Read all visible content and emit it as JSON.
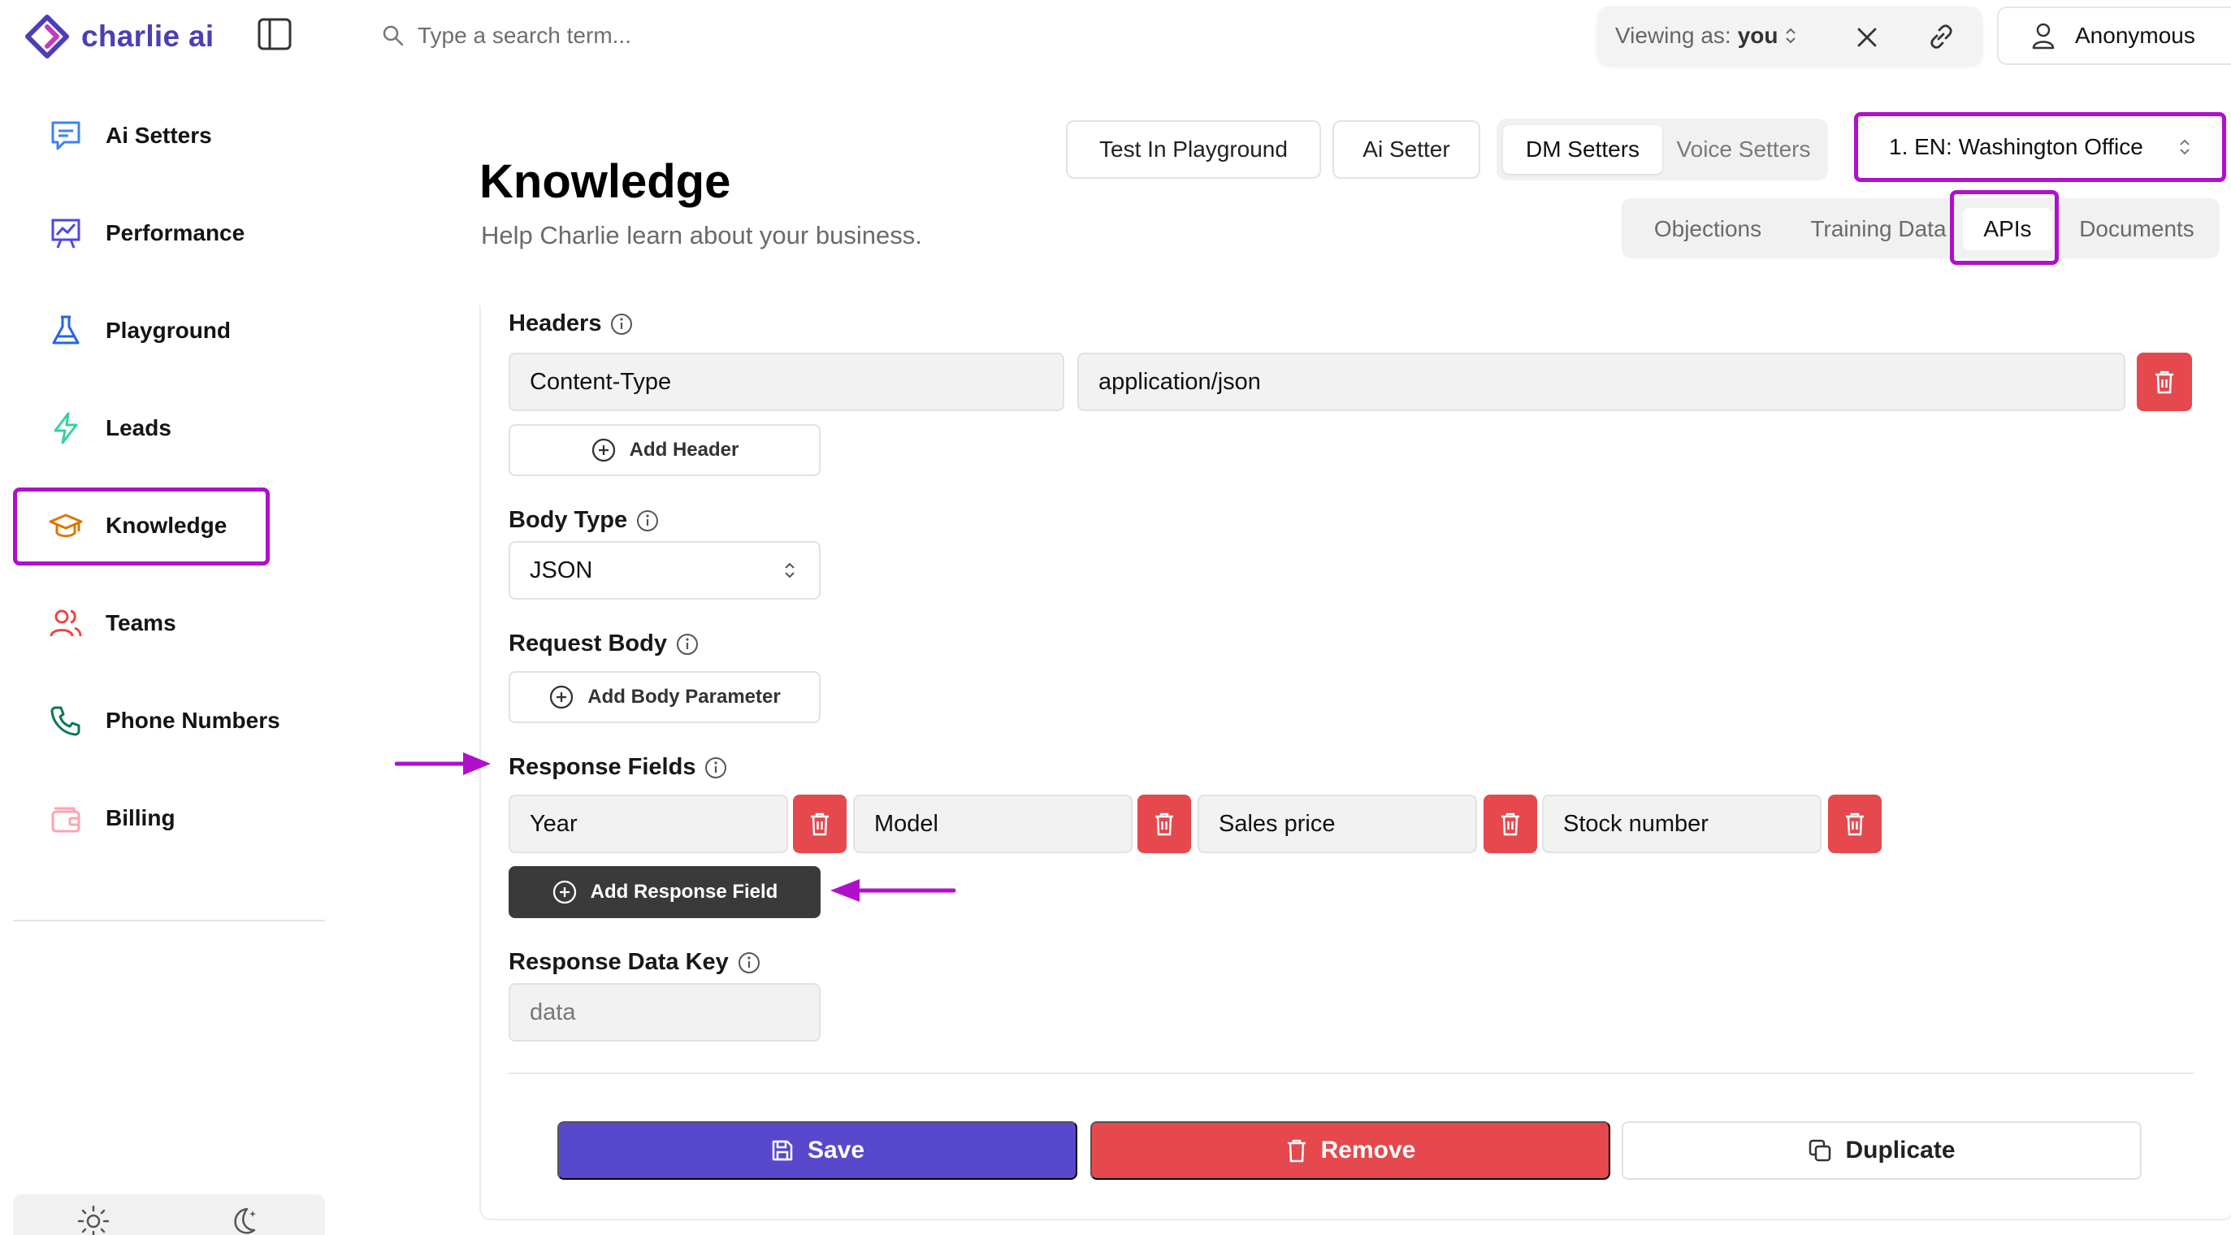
{
  "app": {
    "name": "charlie ai"
  },
  "search": {
    "placeholder": "Type a search term..."
  },
  "viewing": {
    "prefix": "Viewing as:",
    "value": "you"
  },
  "user": {
    "name": "Anonymous"
  },
  "sidebar": {
    "items": [
      {
        "label": "Ai Setters",
        "icon": "chat-icon"
      },
      {
        "label": "Performance",
        "icon": "chart-icon"
      },
      {
        "label": "Playground",
        "icon": "flask-icon"
      },
      {
        "label": "Leads",
        "icon": "lightning-icon"
      },
      {
        "label": "Knowledge",
        "icon": "graduation-cap-icon"
      },
      {
        "label": "Teams",
        "icon": "users-icon"
      },
      {
        "label": "Phone Numbers",
        "icon": "phone-icon"
      },
      {
        "label": "Billing",
        "icon": "wallet-icon"
      }
    ]
  },
  "header": {
    "title": "Knowledge",
    "subtitle": "Help Charlie learn about your business.",
    "test_playground": "Test In Playground",
    "ai_setter": "Ai Setter",
    "setter_types": [
      "DM Setters",
      "Voice Setters"
    ],
    "office": "1. EN: Washington Office",
    "tabs": [
      "Objections",
      "Training Data",
      "APIs",
      "Documents"
    ]
  },
  "form": {
    "headers": {
      "label": "Headers",
      "rows": [
        {
          "key": "Content-Type",
          "value": "application/json"
        }
      ],
      "add_label": "Add Header"
    },
    "body_type": {
      "label": "Body Type",
      "value": "JSON"
    },
    "request_body": {
      "label": "Request Body",
      "add_label": "Add Body Parameter"
    },
    "response_fields": {
      "label": "Response Fields",
      "fields": [
        "Year",
        "Model",
        "Sales price",
        "Stock number"
      ],
      "add_label": "Add Response Field"
    },
    "response_data_key": {
      "label": "Response Data Key",
      "placeholder": "data"
    }
  },
  "actions": {
    "save": "Save",
    "remove": "Remove",
    "duplicate": "Duplicate"
  },
  "colors": {
    "accent": "#5848cc",
    "danger": "#e5484d",
    "highlight": "#b00fcc"
  }
}
